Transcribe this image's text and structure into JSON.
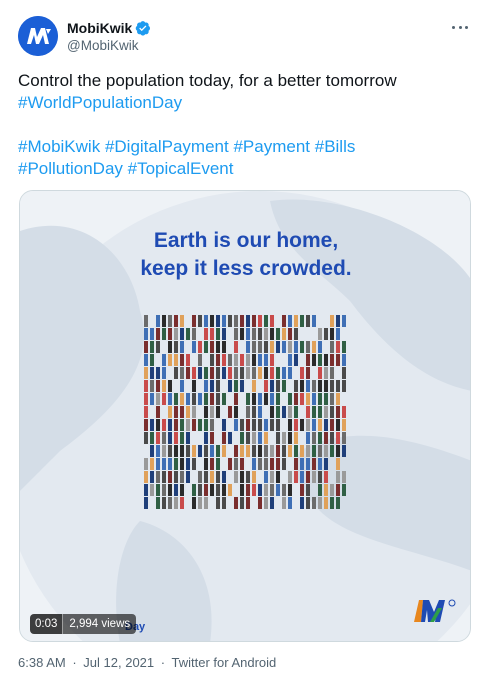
{
  "tweet": {
    "display_name": "MobiKwik",
    "handle": "@MobiKwik",
    "verified_color": "#1d9bf0",
    "text_line": "Control the population today, for a better tomorrow",
    "hashtags_line1": [
      "#WorldPopulationDay"
    ],
    "hashtags_line2": [
      "#MobiKwik",
      "#DigitalPayment",
      "#Payment",
      "#Bills"
    ],
    "hashtags_line3": [
      "#PollutionDay",
      "#TopicalEvent"
    ],
    "hashtag_color": "#1d9bf0"
  },
  "media": {
    "headline_line1": "Earth is our home,",
    "headline_line2": "keep it less crowded.",
    "caption_fragment": "Day",
    "video_time": "0:03",
    "video_views": "2,994 views",
    "headline_color": "#1f4bb3"
  },
  "meta": {
    "time": "6:38 AM",
    "date": "Jul 12, 2021",
    "source": "Twitter for Android",
    "separator": "·"
  }
}
